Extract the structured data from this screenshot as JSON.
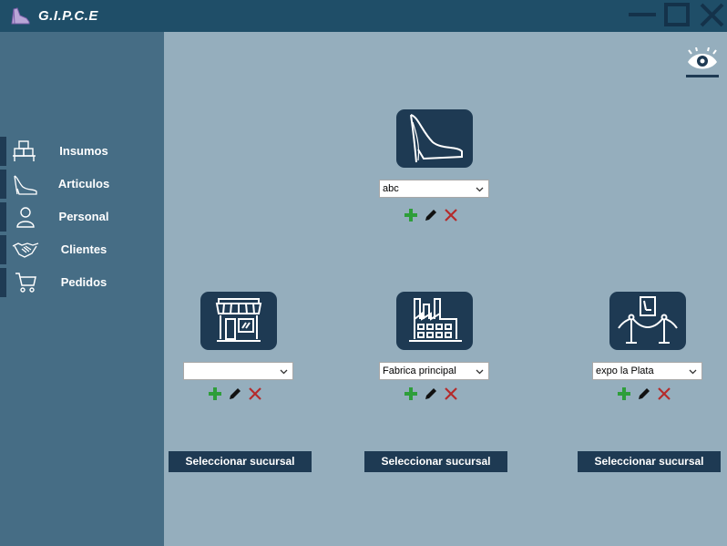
{
  "app": {
    "title": "G.I.P.C.E",
    "colors": {
      "titlebar": "#1f4e68",
      "sidebar": "#466d85",
      "content": "#95aebd",
      "accent_dark": "#1e3a53",
      "add": "#2e9e3a",
      "delete": "#b52b2b"
    }
  },
  "window_controls": [
    "minimize-icon",
    "maximize-icon",
    "close-icon"
  ],
  "sidebar": {
    "items": [
      {
        "label": "Insumos",
        "icon": "supplies-icon"
      },
      {
        "label": "Articulos",
        "icon": "high-heel-icon"
      },
      {
        "label": "Personal",
        "icon": "person-icon"
      },
      {
        "label": "Clientes",
        "icon": "handshake-icon"
      },
      {
        "label": "Pedidos",
        "icon": "cart-icon"
      }
    ]
  },
  "toolbar": {
    "visibility_icon": "eye-icon"
  },
  "article_card": {
    "icon": "high-heel-icon",
    "selected": "abc"
  },
  "branches": [
    {
      "icon": "store-icon",
      "selected": "",
      "button_label": "Seleccionar sucursal"
    },
    {
      "icon": "factory-icon",
      "selected": "Fabrica principal",
      "button_label": "Seleccionar sucursal"
    },
    {
      "icon": "exhibition-icon",
      "selected": "expo la Plata",
      "button_label": "Seleccionar sucursal"
    }
  ]
}
